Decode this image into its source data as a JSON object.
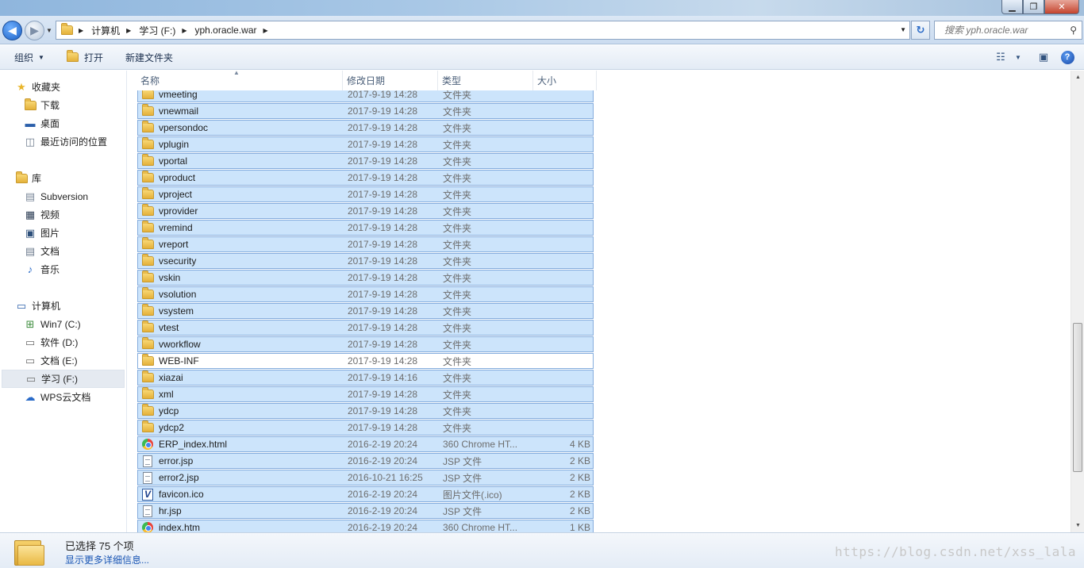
{
  "window": {
    "controls": {
      "minimize": "▁",
      "maximize": "❐",
      "close": "✕"
    }
  },
  "address": {
    "crumbs": [
      "计算机",
      "学习 (F:)",
      "yph.oracle.war"
    ],
    "search_placeholder": "搜索 yph.oracle.war"
  },
  "toolbar": {
    "organize": "组织",
    "open": "打开",
    "new_folder": "新建文件夹"
  },
  "nav": {
    "favorites": {
      "label": "收藏夹",
      "items": [
        "下载",
        "桌面",
        "最近访问的位置"
      ]
    },
    "libraries": {
      "label": "库",
      "items": [
        "Subversion",
        "视频",
        "图片",
        "文档",
        "音乐"
      ]
    },
    "computer": {
      "label": "计算机",
      "items": [
        "Win7 (C:)",
        "软件 (D:)",
        "文档 (E:)",
        "学习 (F:)"
      ],
      "selected": "学习 (F:)"
    },
    "wps": "WPS云文档"
  },
  "columns": {
    "name": "名称",
    "date": "修改日期",
    "type": "类型",
    "size": "大小"
  },
  "files": [
    {
      "name": "vmeeting",
      "date": "2017-9-19 14:28",
      "type": "文件夹",
      "size": "",
      "icon": "folder",
      "selected": true
    },
    {
      "name": "vnewmail",
      "date": "2017-9-19 14:28",
      "type": "文件夹",
      "size": "",
      "icon": "folder",
      "selected": true
    },
    {
      "name": "vpersondoc",
      "date": "2017-9-19 14:28",
      "type": "文件夹",
      "size": "",
      "icon": "folder",
      "selected": true
    },
    {
      "name": "vplugin",
      "date": "2017-9-19 14:28",
      "type": "文件夹",
      "size": "",
      "icon": "folder",
      "selected": true
    },
    {
      "name": "vportal",
      "date": "2017-9-19 14:28",
      "type": "文件夹",
      "size": "",
      "icon": "folder",
      "selected": true
    },
    {
      "name": "vproduct",
      "date": "2017-9-19 14:28",
      "type": "文件夹",
      "size": "",
      "icon": "folder",
      "selected": true
    },
    {
      "name": "vproject",
      "date": "2017-9-19 14:28",
      "type": "文件夹",
      "size": "",
      "icon": "folder",
      "selected": true
    },
    {
      "name": "vprovider",
      "date": "2017-9-19 14:28",
      "type": "文件夹",
      "size": "",
      "icon": "folder",
      "selected": true
    },
    {
      "name": "vremind",
      "date": "2017-9-19 14:28",
      "type": "文件夹",
      "size": "",
      "icon": "folder",
      "selected": true
    },
    {
      "name": "vreport",
      "date": "2017-9-19 14:28",
      "type": "文件夹",
      "size": "",
      "icon": "folder",
      "selected": true
    },
    {
      "name": "vsecurity",
      "date": "2017-9-19 14:28",
      "type": "文件夹",
      "size": "",
      "icon": "folder",
      "selected": true
    },
    {
      "name": "vskin",
      "date": "2017-9-19 14:28",
      "type": "文件夹",
      "size": "",
      "icon": "folder",
      "selected": true
    },
    {
      "name": "vsolution",
      "date": "2017-9-19 14:28",
      "type": "文件夹",
      "size": "",
      "icon": "folder",
      "selected": true
    },
    {
      "name": "vsystem",
      "date": "2017-9-19 14:28",
      "type": "文件夹",
      "size": "",
      "icon": "folder",
      "selected": true
    },
    {
      "name": "vtest",
      "date": "2017-9-19 14:28",
      "type": "文件夹",
      "size": "",
      "icon": "folder",
      "selected": true
    },
    {
      "name": "vworkflow",
      "date": "2017-9-19 14:28",
      "type": "文件夹",
      "size": "",
      "icon": "folder",
      "selected": true
    },
    {
      "name": "WEB-INF",
      "date": "2017-9-19 14:28",
      "type": "文件夹",
      "size": "",
      "icon": "folder",
      "selected": false
    },
    {
      "name": "xiazai",
      "date": "2017-9-19 14:16",
      "type": "文件夹",
      "size": "",
      "icon": "folder",
      "selected": true
    },
    {
      "name": "xml",
      "date": "2017-9-19 14:28",
      "type": "文件夹",
      "size": "",
      "icon": "folder",
      "selected": true
    },
    {
      "name": "ydcp",
      "date": "2017-9-19 14:28",
      "type": "文件夹",
      "size": "",
      "icon": "folder",
      "selected": true
    },
    {
      "name": "ydcp2",
      "date": "2017-9-19 14:28",
      "type": "文件夹",
      "size": "",
      "icon": "folder",
      "selected": true
    },
    {
      "name": "ERP_index.html",
      "date": "2016-2-19 20:24",
      "type": "360 Chrome HT...",
      "size": "4 KB",
      "icon": "chrome",
      "selected": true
    },
    {
      "name": "error.jsp",
      "date": "2016-2-19 20:24",
      "type": "JSP 文件",
      "size": "2 KB",
      "icon": "doc",
      "selected": true
    },
    {
      "name": "error2.jsp",
      "date": "2016-10-21 16:25",
      "type": "JSP 文件",
      "size": "2 KB",
      "icon": "doc",
      "selected": true
    },
    {
      "name": "favicon.ico",
      "date": "2016-2-19 20:24",
      "type": "图片文件(.ico)",
      "size": "2 KB",
      "icon": "ico",
      "selected": true
    },
    {
      "name": "hr.jsp",
      "date": "2016-2-19 20:24",
      "type": "JSP 文件",
      "size": "2 KB",
      "icon": "doc",
      "selected": true
    },
    {
      "name": "index.htm",
      "date": "2016-2-19 20:24",
      "type": "360 Chrome HT...",
      "size": "1 KB",
      "icon": "chrome",
      "selected": true
    }
  ],
  "status": {
    "selected_count": "已选择 75 个项",
    "more_details": "显示更多详细信息..."
  },
  "watermark": "https://blog.csdn.net/xss_lala"
}
